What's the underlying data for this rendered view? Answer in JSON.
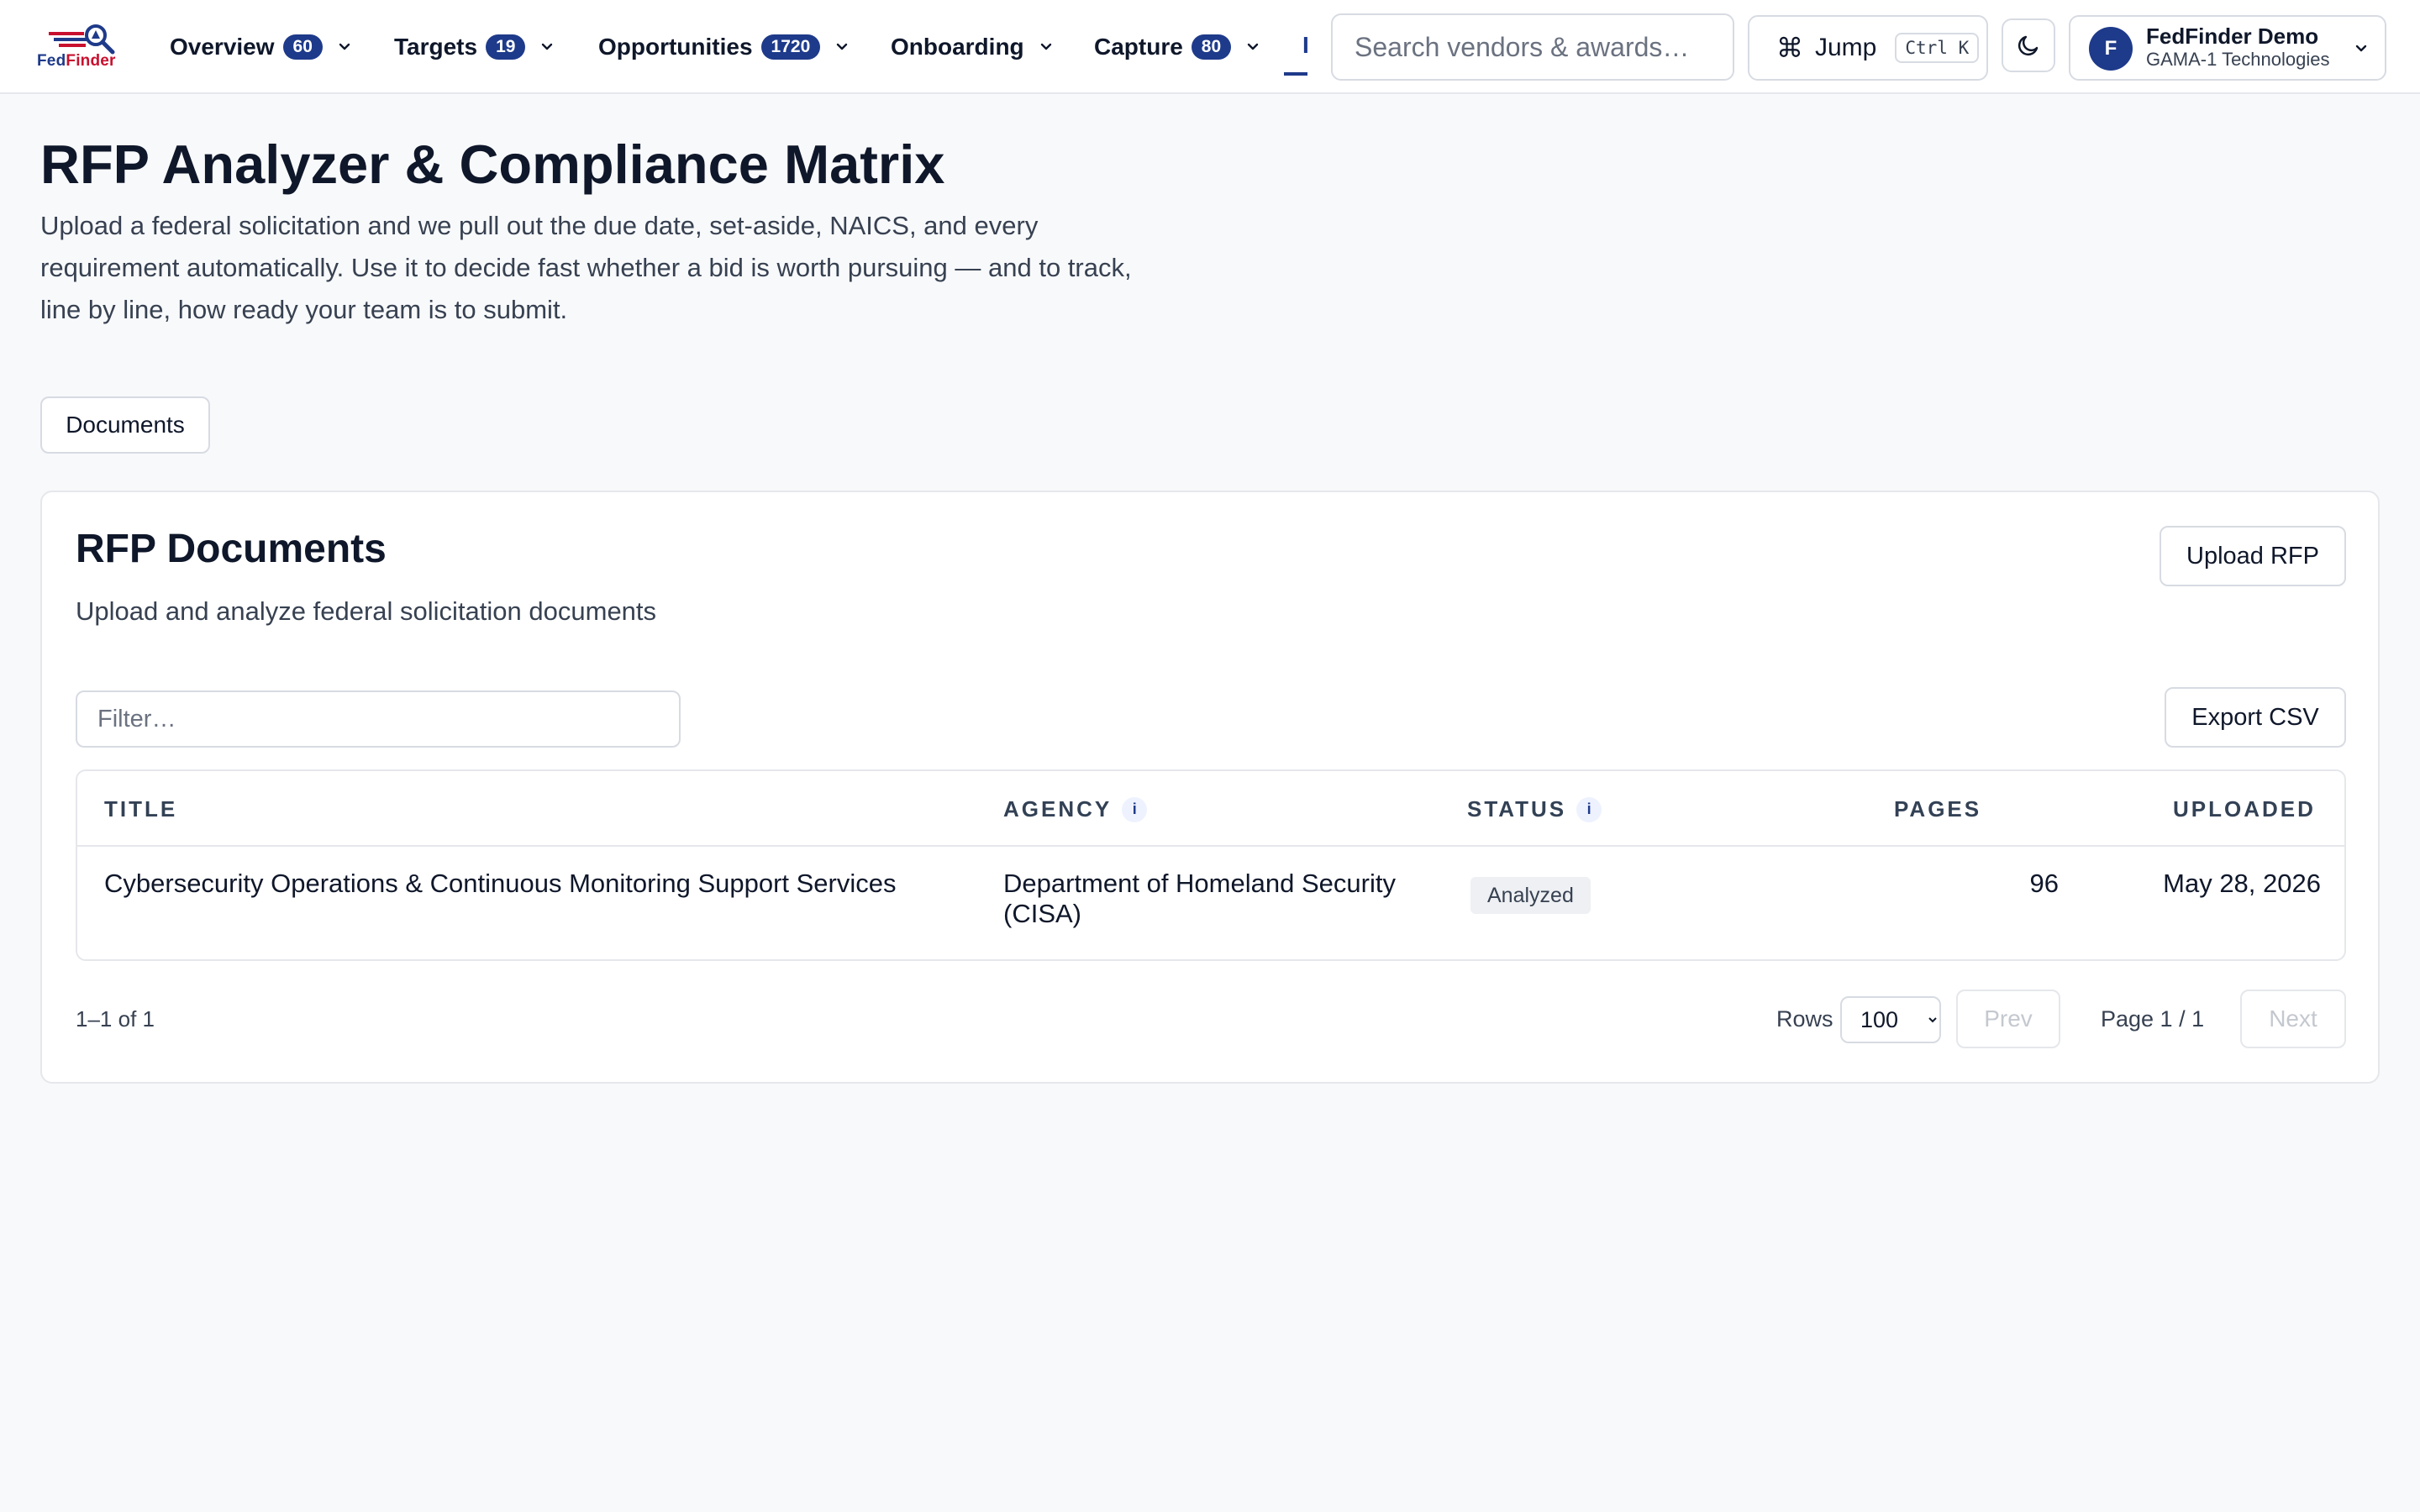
{
  "brand": {
    "name_part1": "Fed",
    "name_part2": "Finder",
    "primary": "#1e3a8a",
    "accent": "#c8102e"
  },
  "nav": {
    "items": [
      {
        "label": "Overview",
        "badge": "60"
      },
      {
        "label": "Targets",
        "badge": "19"
      },
      {
        "label": "Opportunities",
        "badge": "1720"
      },
      {
        "label": "Onboarding",
        "badge": ""
      },
      {
        "label": "Capture",
        "badge": "80"
      }
    ],
    "truncated_active_label": "I"
  },
  "search": {
    "placeholder": "Search vendors & awards…"
  },
  "jump": {
    "icon": "command-icon",
    "label": "Jump",
    "shortcut": "Ctrl K"
  },
  "theme_toggle": {
    "icon": "moon-icon"
  },
  "account": {
    "initial": "F",
    "name": "FedFinder Demo",
    "org": "GAMA-1 Technologies"
  },
  "header": {
    "title": "RFP Analyzer & Compliance Matrix",
    "description": "Upload a federal solicitation and we pull out the due date, set-aside, NAICS, and every requirement automatically. Use it to decide fast whether a bid is worth pursuing — and to track, line by line, how ready your team is to submit."
  },
  "tabs": [
    {
      "label": "Documents"
    }
  ],
  "card": {
    "title": "RFP Documents",
    "subtitle": "Upload and analyze federal solicitation documents",
    "upload_label": "Upload RFP",
    "filter_placeholder": "Filter…",
    "export_label": "Export CSV"
  },
  "table": {
    "columns": {
      "title": "TITLE",
      "agency": "AGENCY",
      "status": "STATUS",
      "pages": "PAGES",
      "uploaded": "UPLOADED"
    },
    "info_glyph": "i",
    "rows": [
      {
        "title": "Cybersecurity Operations & Continuous Monitoring Support Services",
        "agency": "Department of Homeland Security (CISA)",
        "status": "Analyzed",
        "pages": "96",
        "uploaded": "May 28, 2026"
      }
    ]
  },
  "pagination": {
    "count": "1–1 of 1",
    "rows_label": "Rows",
    "rows_value": "100",
    "prev_label": "Prev",
    "page_indicator": "Page 1 / 1",
    "next_label": "Next"
  }
}
